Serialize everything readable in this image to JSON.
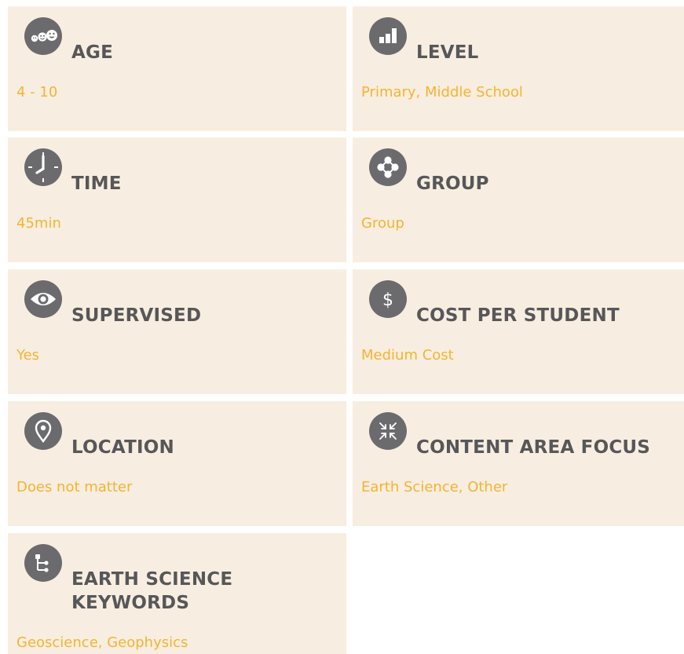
{
  "cards": [
    {
      "title": "AGE",
      "value": "4 - 10",
      "icon": "kids-faces-icon"
    },
    {
      "title": "LEVEL",
      "value": "Primary, Middle School",
      "icon": "bar-chart-icon"
    },
    {
      "title": "TIME",
      "value": "45min",
      "icon": "clock-icon"
    },
    {
      "title": "GROUP",
      "value": "Group",
      "icon": "group-circles-icon"
    },
    {
      "title": "SUPERVISED",
      "value": "Yes",
      "icon": "eye-icon"
    },
    {
      "title": "COST PER STUDENT",
      "value": "Medium Cost",
      "icon": "dollar-icon"
    },
    {
      "title": "LOCATION",
      "value": "Does not matter",
      "icon": "location-pin-icon"
    },
    {
      "title": "CONTENT AREA FOCUS",
      "value": "Earth Science, Other",
      "icon": "collapse-arrows-icon"
    },
    {
      "title": "EARTH SCIENCE KEYWORDS",
      "value": "Geoscience, Geophysics",
      "icon": "tree-hierarchy-icon"
    }
  ],
  "colors": {
    "card_background": "#f7eee1",
    "icon_background": "#6b6b6d",
    "title": "#575759",
    "value": "#f5b430"
  }
}
